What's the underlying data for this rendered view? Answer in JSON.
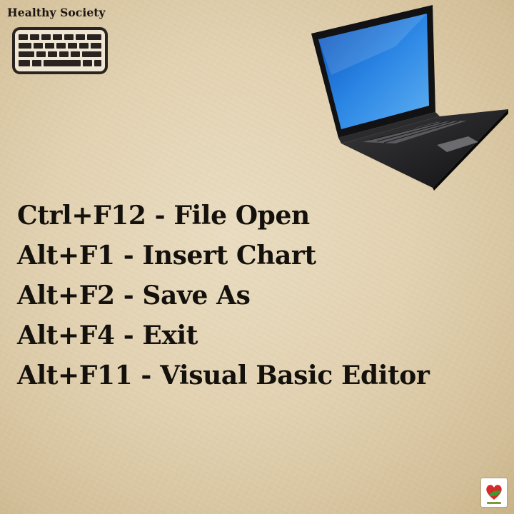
{
  "brand": {
    "title": "Healthy Society",
    "keyboard_icon": "keyboard-icon",
    "laptop_icon": "laptop-icon",
    "badge_icon": "heart-badge-icon"
  },
  "shortcuts": [
    {
      "keys": "Ctrl+F12",
      "separator": " - ",
      "action": "File Open"
    },
    {
      "keys": "Alt+F1",
      "separator": " - ",
      "action": "Insert Chart"
    },
    {
      "keys": "Alt+F2",
      "separator": " - ",
      "action": "Save As"
    },
    {
      "keys": "Alt+F4",
      "separator": " - ",
      "action": "Exit"
    },
    {
      "keys": "Alt+F11",
      "separator": " - ",
      "action": "Visual Basic Editor"
    }
  ],
  "colors": {
    "background": "#e2d2b2",
    "text": "#14100c",
    "laptop_screen": "#1e74d8"
  }
}
